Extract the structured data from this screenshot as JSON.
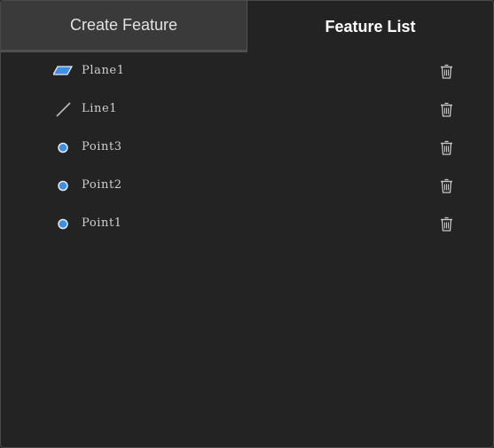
{
  "tabs": {
    "create_feature": "Create Feature",
    "feature_list": "Feature List",
    "active": "feature_list"
  },
  "features": [
    {
      "name": "Plane1",
      "icon": "plane-icon"
    },
    {
      "name": "Line1",
      "icon": "line-icon"
    },
    {
      "name": "Point3",
      "icon": "point-icon"
    },
    {
      "name": "Point2",
      "icon": "point-icon"
    },
    {
      "name": "Point1",
      "icon": "point-icon"
    }
  ],
  "colors": {
    "accent": "#3d8fe6",
    "background": "#232323",
    "text": "#cfcfcf"
  }
}
